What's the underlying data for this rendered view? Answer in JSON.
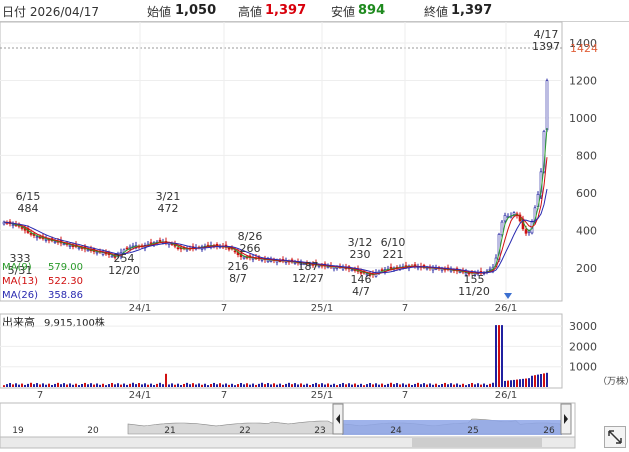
{
  "header": {
    "date_label": "日付 2026/04/17",
    "open_label": "始値",
    "open_value": "1,050",
    "high_label": "高値",
    "high_value": "1,397",
    "low_label": "安値",
    "low_value": "894",
    "close_label": "終値",
    "close_value": "1,397"
  },
  "colors": {
    "bull": "#2020a0",
    "bear": "#d01010",
    "ma9": "#2a9a2a",
    "ma13": "#d01010",
    "ma26": "#2a2ab0",
    "volume_up": "#d01010",
    "volume_down": "#2020a0",
    "navigator_fill": "#8ea6e8",
    "last_price": "#e0603a"
  },
  "chart_data": [
    {
      "type": "candlestick",
      "price_axis": {
        "ticks": [
          200,
          400,
          600,
          800,
          1000,
          1200,
          1400
        ],
        "last_price_label": "1424",
        "last_price": 1424
      },
      "ylim": [
        60,
        1480
      ],
      "x_ticks": [
        "24/1",
        "7",
        "25/1",
        "7",
        "26/1"
      ],
      "moving_averages": [
        {
          "name": "MA(9)",
          "value": "579.00"
        },
        {
          "name": "MA(13)",
          "value": "522.30"
        },
        {
          "name": "MA(26)",
          "value": "358.86"
        }
      ],
      "annotations": [
        {
          "date": "6/15",
          "price": "484",
          "pos": "above"
        },
        {
          "date": "5/31",
          "price": "333",
          "pos": "below"
        },
        {
          "date": "12/20",
          "price": "254",
          "pos": "below"
        },
        {
          "date": "3/21",
          "price": "472",
          "pos": "above"
        },
        {
          "date": "8/26",
          "price": "266",
          "pos": "above"
        },
        {
          "date": "8/7",
          "price": "216",
          "pos": "below"
        },
        {
          "date": "12/27",
          "price": "187",
          "pos": "below"
        },
        {
          "date": "3/12",
          "price": "230",
          "pos": "above"
        },
        {
          "date": "4/7",
          "price": "146",
          "pos": "below"
        },
        {
          "date": "6/10",
          "price": "221",
          "pos": "above"
        },
        {
          "date": "11/20",
          "price": "155",
          "pos": "below"
        },
        {
          "date": "4/17",
          "price": "1397",
          "pos": "above"
        }
      ]
    },
    {
      "type": "bar",
      "title": "出来高",
      "latest": "9,915,100株",
      "unit": "（万株）",
      "ticks": [
        1000,
        2000,
        3000
      ],
      "ylim": [
        0,
        3400
      ],
      "x_ticks": [
        "7",
        "24/1",
        "7",
        "25/1",
        "7",
        "26/1"
      ]
    }
  ],
  "navigator": {
    "year_labels": [
      "19",
      "20",
      "21",
      "22",
      "23",
      "24",
      "25",
      "26"
    ]
  }
}
